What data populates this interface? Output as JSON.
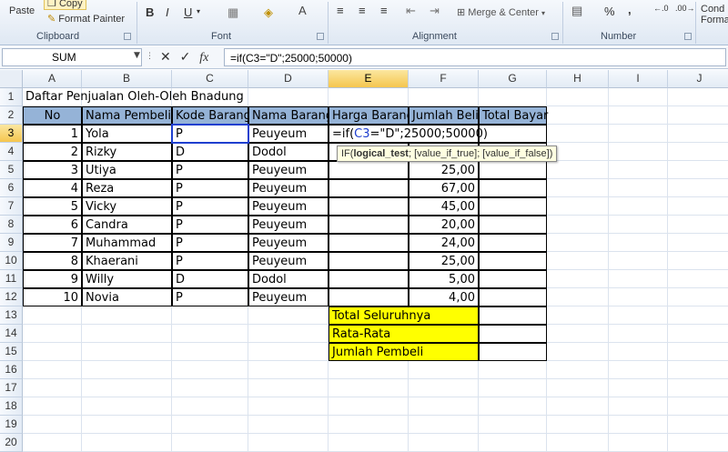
{
  "ribbon": {
    "clipboard": {
      "label": "Clipboard",
      "paste": "Paste",
      "copy": "Copy",
      "format_painter": "Format Painter"
    },
    "font": {
      "label": "Font",
      "bold": "B",
      "italic": "I",
      "underline": "U"
    },
    "alignment": {
      "label": "Alignment",
      "merge_center": "Merge & Center"
    },
    "number": {
      "label": "Number",
      "percent": "%",
      "comma": ","
    },
    "styles": {
      "cond": "Cond",
      "forma": "Forma"
    }
  },
  "formula_bar": {
    "name_box": "SUM",
    "fx": "fx",
    "cancel": "✕",
    "enter": "✓",
    "formula": "=if(C3=\"D\";25000;50000)"
  },
  "columns": [
    "A",
    "B",
    "C",
    "D",
    "E",
    "F",
    "G",
    "H",
    "I",
    "J"
  ],
  "rows": [
    "1",
    "2",
    "3",
    "4",
    "5",
    "6",
    "7",
    "8",
    "9",
    "10",
    "11",
    "12",
    "13",
    "14",
    "15",
    "16",
    "17",
    "18",
    "19",
    "20"
  ],
  "sheet": {
    "title": "Daftar Penjualan Oleh-Oleh Bnadung",
    "headers": [
      "No",
      "Nama Pembeli",
      "Kode Barang",
      "Nama Barang",
      "Harga Barang",
      "Jumlah Beli",
      "Total Bayar"
    ],
    "records": [
      {
        "no": "1",
        "nama": "Yola",
        "kode": "P",
        "barang": "Peuyeum",
        "jumlah": ""
      },
      {
        "no": "2",
        "nama": "Rizky",
        "kode": "D",
        "barang": "Dodol",
        "jumlah": ""
      },
      {
        "no": "3",
        "nama": "Utiya",
        "kode": "P",
        "barang": "Peuyeum",
        "jumlah": "25,00"
      },
      {
        "no": "4",
        "nama": "Reza",
        "kode": "P",
        "barang": "Peuyeum",
        "jumlah": "67,00"
      },
      {
        "no": "5",
        "nama": "Vicky",
        "kode": "P",
        "barang": "Peuyeum",
        "jumlah": "45,00"
      },
      {
        "no": "6",
        "nama": "Candra",
        "kode": "P",
        "barang": "Peuyeum",
        "jumlah": "20,00"
      },
      {
        "no": "7",
        "nama": "Muhammad",
        "kode": "P",
        "barang": "Peuyeum",
        "jumlah": "24,00"
      },
      {
        "no": "8",
        "nama": "Khaerani",
        "kode": "P",
        "barang": "Peuyeum",
        "jumlah": "25,00"
      },
      {
        "no": "9",
        "nama": "Willy",
        "kode": "D",
        "barang": "Dodol",
        "jumlah": "5,00"
      },
      {
        "no": "10",
        "nama": "Novia",
        "kode": "P",
        "barang": "Peuyeum",
        "jumlah": "4,00"
      }
    ],
    "summary": [
      "Total Seluruhnya",
      "Rata-Rata",
      "Jumlah Pembeli"
    ],
    "edit_parts": {
      "pre": "=if(",
      "ref": "C3",
      "post": "=\"D\";25000;50000)"
    }
  },
  "tooltip": {
    "fn": "IF(",
    "arg1": "logical_test",
    "rest": "; [value_if_true]; [value_if_false])"
  },
  "colors": {
    "header_fill": "#95b3d7",
    "summary_fill": "#ffff00",
    "selection": "#1f3fcf"
  }
}
